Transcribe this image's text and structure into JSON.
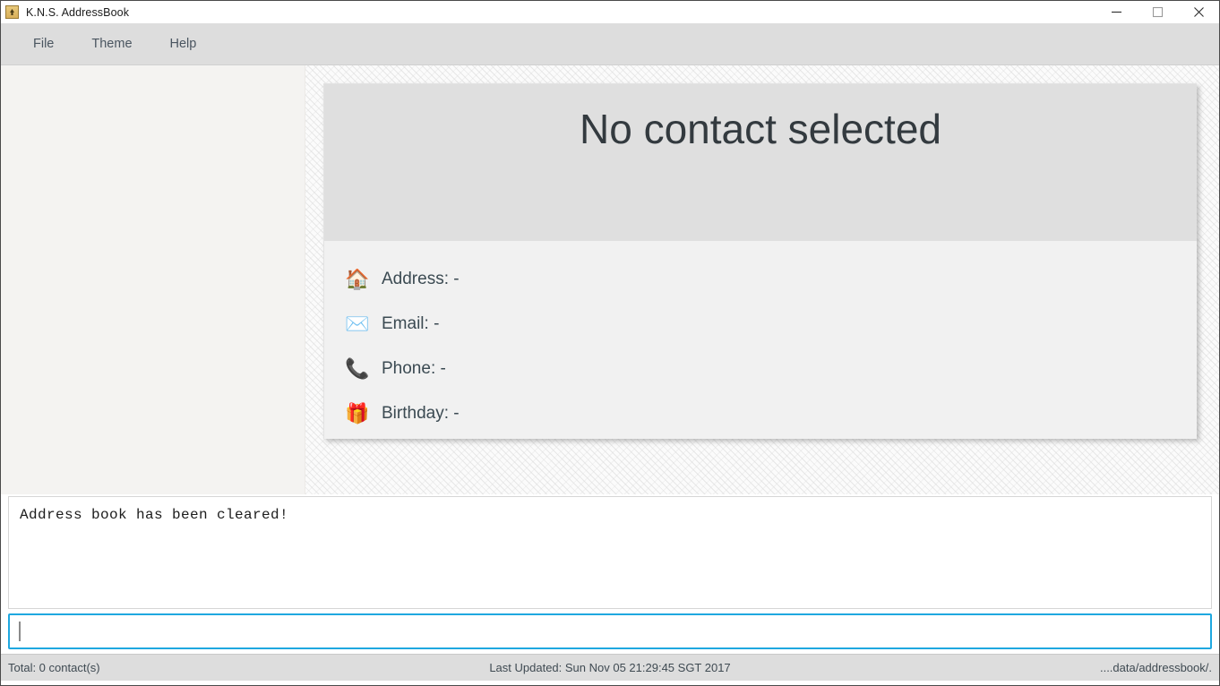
{
  "window": {
    "title": "K.N.S. AddressBook",
    "app_icon": "java-app-icon",
    "controls": {
      "minimize": "minimize-icon",
      "maximize": "maximize-icon",
      "close": "close-icon"
    }
  },
  "menubar": {
    "items": [
      {
        "label": "File"
      },
      {
        "label": "Theme"
      },
      {
        "label": "Help"
      }
    ]
  },
  "contact_card": {
    "name": "No contact selected",
    "details": [
      {
        "icon": "house-icon",
        "glyph": "🏠",
        "text": "Address: -"
      },
      {
        "icon": "envelope-icon",
        "glyph": "✉️",
        "text": "Email: -"
      },
      {
        "icon": "telephone-icon",
        "glyph": "📞",
        "text": "Phone: -"
      },
      {
        "icon": "gift-icon",
        "glyph": "🎁",
        "text": "Birthday: -"
      }
    ]
  },
  "result_display": {
    "text": "Address book has been cleared!"
  },
  "command_box": {
    "value": "",
    "placeholder": ""
  },
  "statusbar": {
    "total": "Total: 0 contact(s)",
    "last_updated": "Last Updated: Sun Nov 05 21:29:45 SGT 2017",
    "save_location": "....data/addressbook/."
  },
  "colors": {
    "menubar_bg": "#dddddd",
    "card_header_bg": "#dfdfdf",
    "card_body_bg": "#f1f1f1",
    "left_pane_bg": "#f4f3f1",
    "focus_border": "#1fa8e0",
    "text_dark": "#333a3f",
    "text_muted": "#3f4a52"
  }
}
